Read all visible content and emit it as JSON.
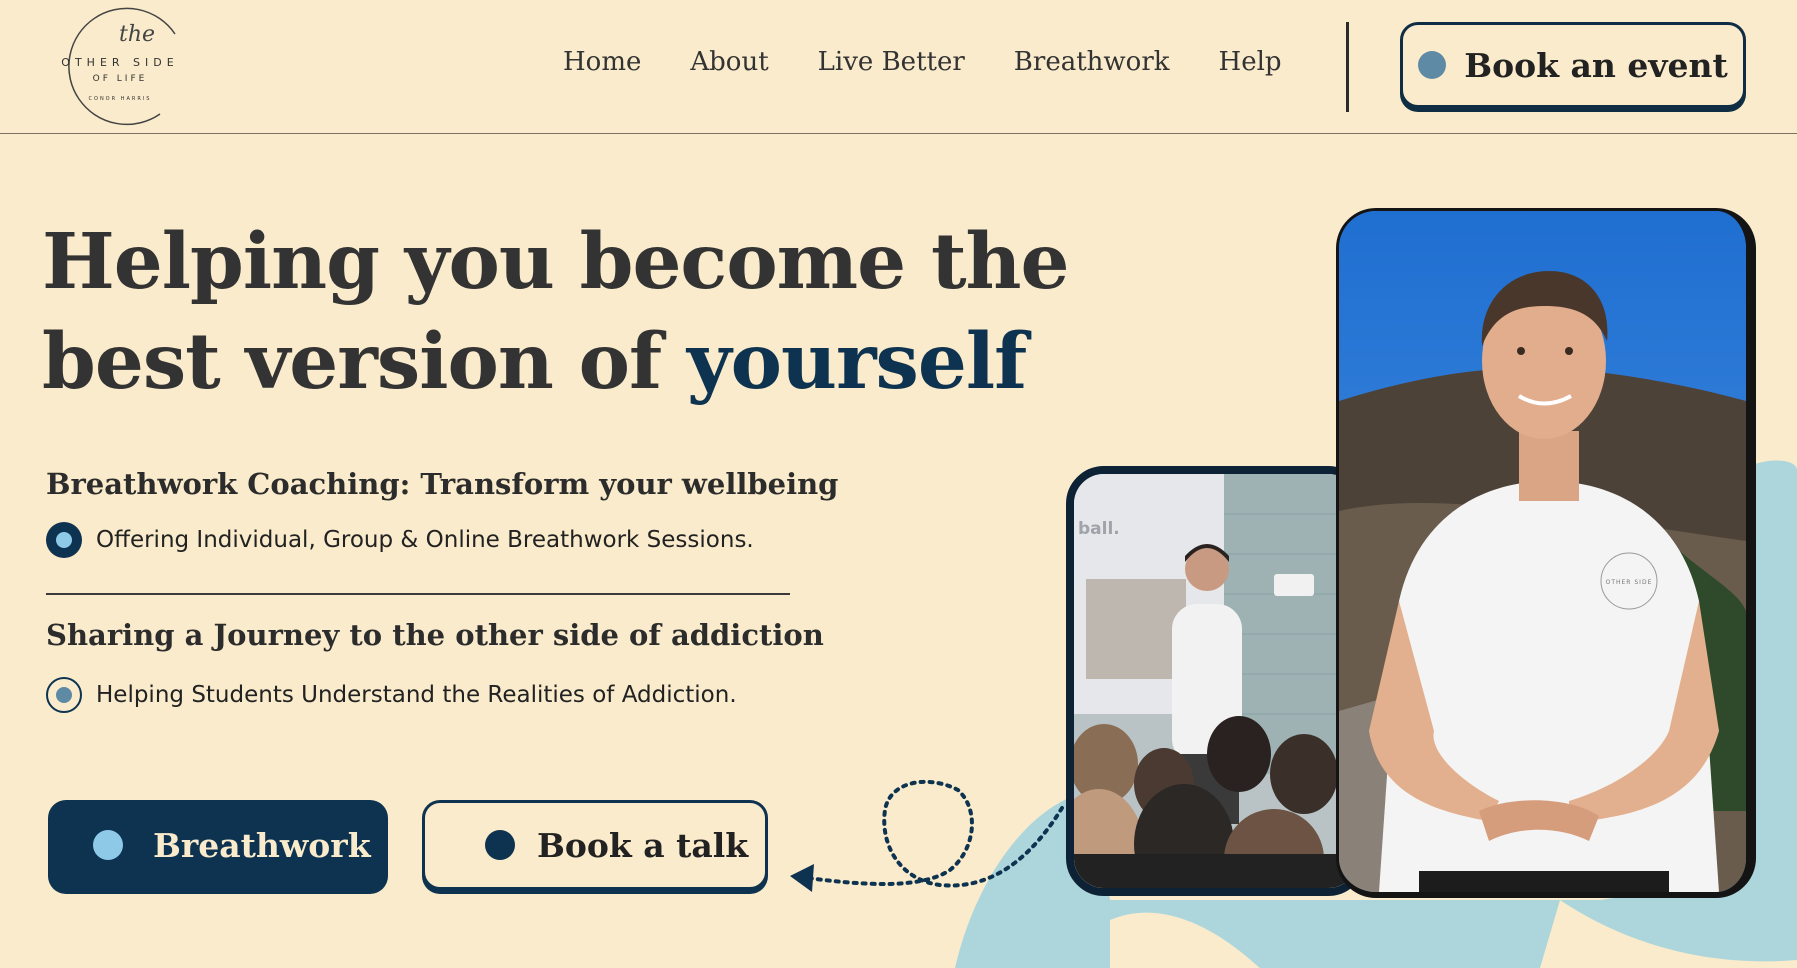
{
  "header": {
    "logo": {
      "script": "the",
      "line1": "OTHER SIDE",
      "line2": "OF LIFE",
      "line3": "CONOR HARRIS"
    },
    "nav": [
      "Home",
      "About",
      "Live Better",
      "Breathwork",
      "Help"
    ],
    "cta": "Book an event"
  },
  "hero": {
    "headline_main": "Helping you become the best version of ",
    "headline_accent": "yourself",
    "section1": {
      "title": "Breathwork Coaching: Transform your wellbeing",
      "bullet": "Offering Individual, Group & Online Breathwork Sessions."
    },
    "section2": {
      "title": "Sharing a Journey to the other side of addiction",
      "bullet": "Helping Students Understand the Realities of Addiction."
    },
    "buttons": {
      "primary": "Breathwork",
      "secondary": "Book a talk"
    },
    "photo_small_caption": "ball.",
    "shirt_logo": "OTHER SIDE"
  },
  "colors": {
    "background": "#f9ebcb",
    "navy": "#0d3350",
    "light_blue": "#8fc9e8",
    "steel_blue": "#5f8aa5",
    "blob": "#acd6dc"
  }
}
